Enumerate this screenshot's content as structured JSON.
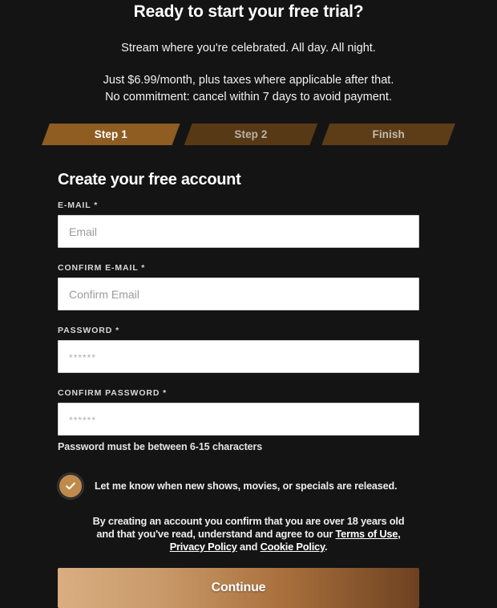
{
  "hero": {
    "title": "Ready to start your free trial?",
    "subtitle": "Stream where you're celebrated. All day. All night.",
    "price_line_1": "Just $6.99/month, plus taxes where applicable after that.",
    "price_line_2": "No commitment: cancel within 7 days to avoid payment."
  },
  "steps": [
    {
      "label": "Step 1",
      "state": "active",
      "color": "#8f5c22"
    },
    {
      "label": "Step 2",
      "state": "inactive",
      "color": "#583916"
    },
    {
      "label": "Finish",
      "state": "inactive",
      "color": "#5c3d18"
    }
  ],
  "form": {
    "title": "Create your free account",
    "fields": [
      {
        "label": "E-MAIL *",
        "placeholder": "Email",
        "value": ""
      },
      {
        "label": "CONFIRM E-MAIL *",
        "placeholder": "Confirm Email",
        "value": ""
      },
      {
        "label": "PASSWORD *",
        "placeholder": "******",
        "value": ""
      },
      {
        "label": "CONFIRM PASSWORD *",
        "placeholder": "******",
        "value": ""
      }
    ],
    "password_hint": "Password must be between 6-15 characters",
    "newsletter": {
      "label": "Let me know when new shows, movies, or specials are released.",
      "checked": true,
      "icon": "check-icon",
      "fill_color": "#c08a4c"
    },
    "legal": {
      "text_1": "By creating an account you confirm that you are over 18 years old and that you've read, understand and agree to our ",
      "link_terms": "Terms of Use",
      "sep_1": ", ",
      "link_privacy": "Privacy Policy",
      "sep_2": " and ",
      "link_cookie": "Cookie Policy",
      "sep_3": "."
    },
    "submit_label": "Continue"
  }
}
